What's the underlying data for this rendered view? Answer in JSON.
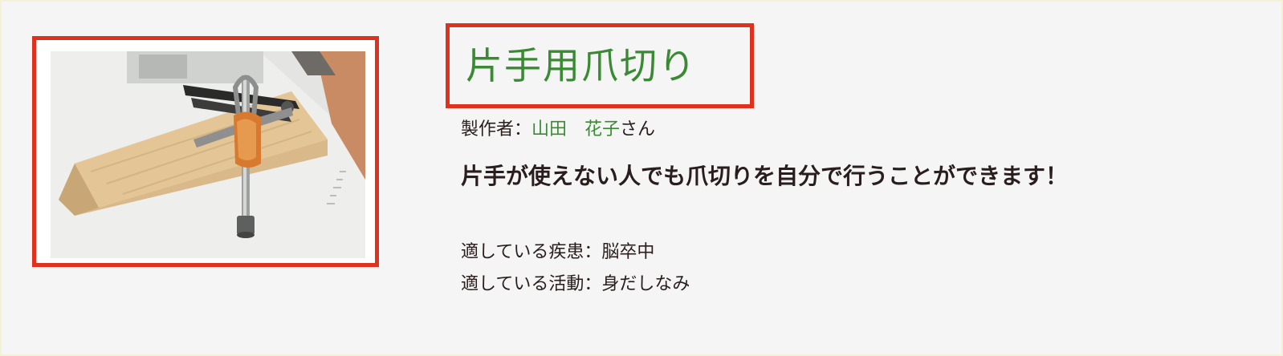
{
  "product": {
    "title": "片手用爪切り",
    "maker_label": "製作者：",
    "maker_name": "山田　花子",
    "maker_suffix": "さん",
    "description": "片手が使えない人でも爪切りを自分で行うことができます！",
    "disease_label": "適している疾患：",
    "disease_value": "脳卒中",
    "activity_label": "適している活動：",
    "activity_value": "身だしなみ"
  },
  "colors": {
    "highlight_border": "#e0311f",
    "accent_green": "#3a8a34",
    "text": "#2a1d1d",
    "background": "#f5f5f5"
  }
}
